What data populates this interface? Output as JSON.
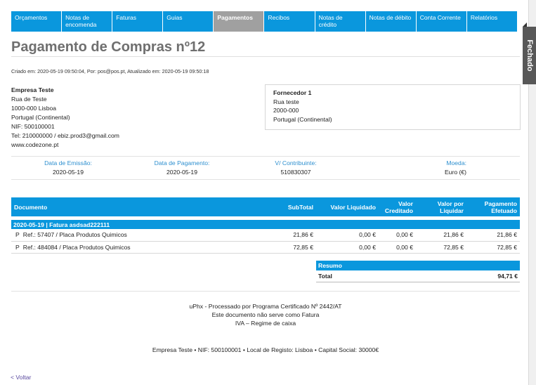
{
  "nav": [
    {
      "label": "Orçamentos",
      "active": false
    },
    {
      "label": "Notas de encomenda",
      "active": false
    },
    {
      "label": "Faturas",
      "active": false
    },
    {
      "label": "Guias",
      "active": false
    },
    {
      "label": "Pagamentos",
      "active": true
    },
    {
      "label": "Recibos",
      "active": false
    },
    {
      "label": "Notas de crédito",
      "active": false
    },
    {
      "label": "Notas de débito",
      "active": false
    },
    {
      "label": "Conta Corrente",
      "active": false
    },
    {
      "label": "Relatórios",
      "active": false
    }
  ],
  "title": "Pagamento de Compras nº12",
  "meta": "Criado em: 2020-05-19 09:50:04, Por: pos@pos.pt, Atualizado em: 2020-05-19 09:50:18",
  "status": "Fechado",
  "company": {
    "name": "Empresa Teste",
    "street": "Rua de Teste",
    "city": "1000-000 Lisboa",
    "country": "Portugal (Continental)",
    "nif": "NIF: 500100001",
    "contact": "Tel: 210000000 / ebiz.prod3@gmail.com",
    "website": "www.codezone.pt"
  },
  "supplier": {
    "name": "Fornecedor 1",
    "street": "Rua teste",
    "postal": "2000-000",
    "country": "Portugal (Continental)"
  },
  "info": {
    "issue_label": "Data de Emissão:",
    "issue_value": "2020-05-19",
    "payment_label": "Data de Pagamento:",
    "payment_value": "2020-05-19",
    "taxpayer_label": "V/ Contribuinte:",
    "taxpayer_value": "510830307",
    "currency_label": "Moeda:",
    "currency_value": "Euro (€)"
  },
  "table": {
    "headers": {
      "document": "Documento",
      "subtotal": "SubTotal",
      "net": "Valor Liquidado",
      "credited": "Valor Creditado",
      "to_settle": "Valor por Liquidar",
      "paid": "Pagamento Efetuado"
    },
    "group": "2020-05-19 | Fatura asdsad222111",
    "rows": [
      {
        "type": "P",
        "ref": "Ref.: 57407 / Placa Produtos Quimicos",
        "subtotal": "21,86 €",
        "net": "0,00 €",
        "credited": "0,00 €",
        "to_settle": "21,86 €",
        "paid": "21,86 €"
      },
      {
        "type": "P",
        "ref": "Ref.: 484084 / Placa Produtos Quimicos",
        "subtotal": "72,85 €",
        "net": "0,00 €",
        "credited": "0,00 €",
        "to_settle": "72,85 €",
        "paid": "72,85 €"
      }
    ]
  },
  "summary": {
    "header": "Resumo",
    "total_label": "Total",
    "total_value": "94,71 €"
  },
  "footer": {
    "line1": "uPhx - Processado por Programa Certificado Nº 2442/AT",
    "line2": "Este documento não serve como Fatura",
    "line3": "IVA – Regime de caixa",
    "company_line": "Empresa Teste • NIF: 500100001 • Local de Registo: Lisboa • Capital Social: 30000€"
  },
  "back": "< Voltar"
}
